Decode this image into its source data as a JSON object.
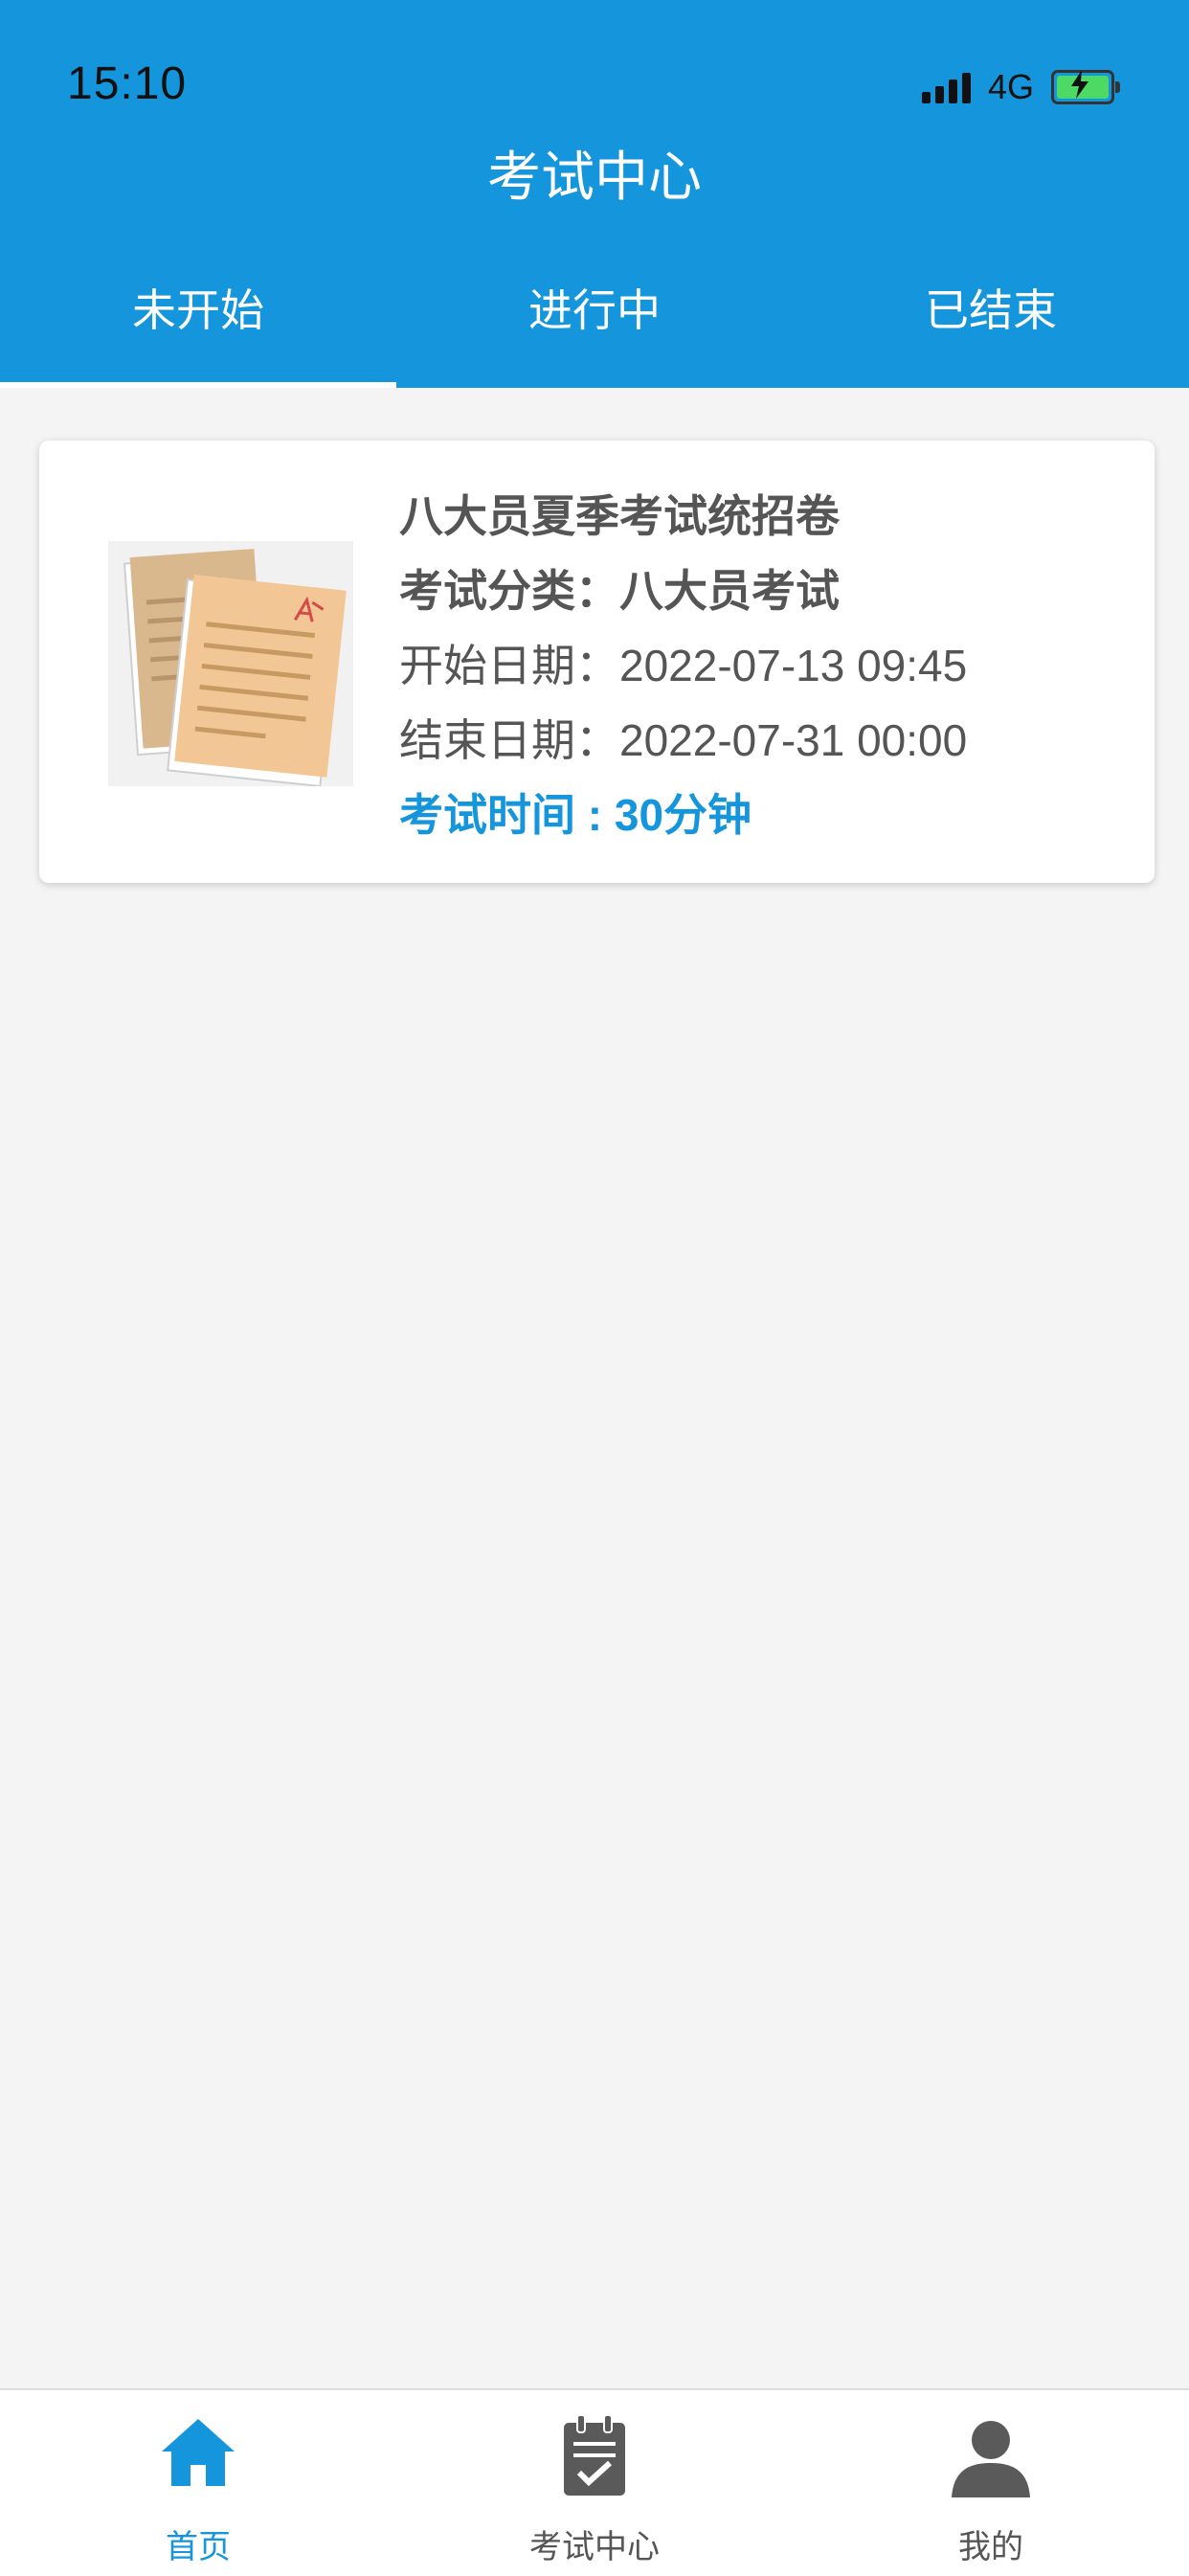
{
  "status": {
    "time": "15:10",
    "network": "4G"
  },
  "header": {
    "title": "考试中心"
  },
  "tabs": [
    {
      "label": "未开始",
      "active": true
    },
    {
      "label": "进行中",
      "active": false
    },
    {
      "label": "已结束",
      "active": false
    }
  ],
  "exam": {
    "title": "八大员夏季考试统招卷",
    "category_label": "考试分类：",
    "category": "八大员考试",
    "start_label": "开始日期：",
    "start": "2022-07-13 09:45",
    "end_label": "结束日期：",
    "end": "2022-07-31 00:00",
    "duration_label": "考试时间 : ",
    "duration": "30分钟"
  },
  "bottom_nav": [
    {
      "label": "首页",
      "icon": "home-icon",
      "active": true
    },
    {
      "label": "考试中心",
      "icon": "clipboard-check-icon",
      "active": false
    },
    {
      "label": "我的",
      "icon": "user-icon",
      "active": false
    }
  ],
  "colors": {
    "primary": "#1596dc",
    "background": "#f4f4f4"
  }
}
